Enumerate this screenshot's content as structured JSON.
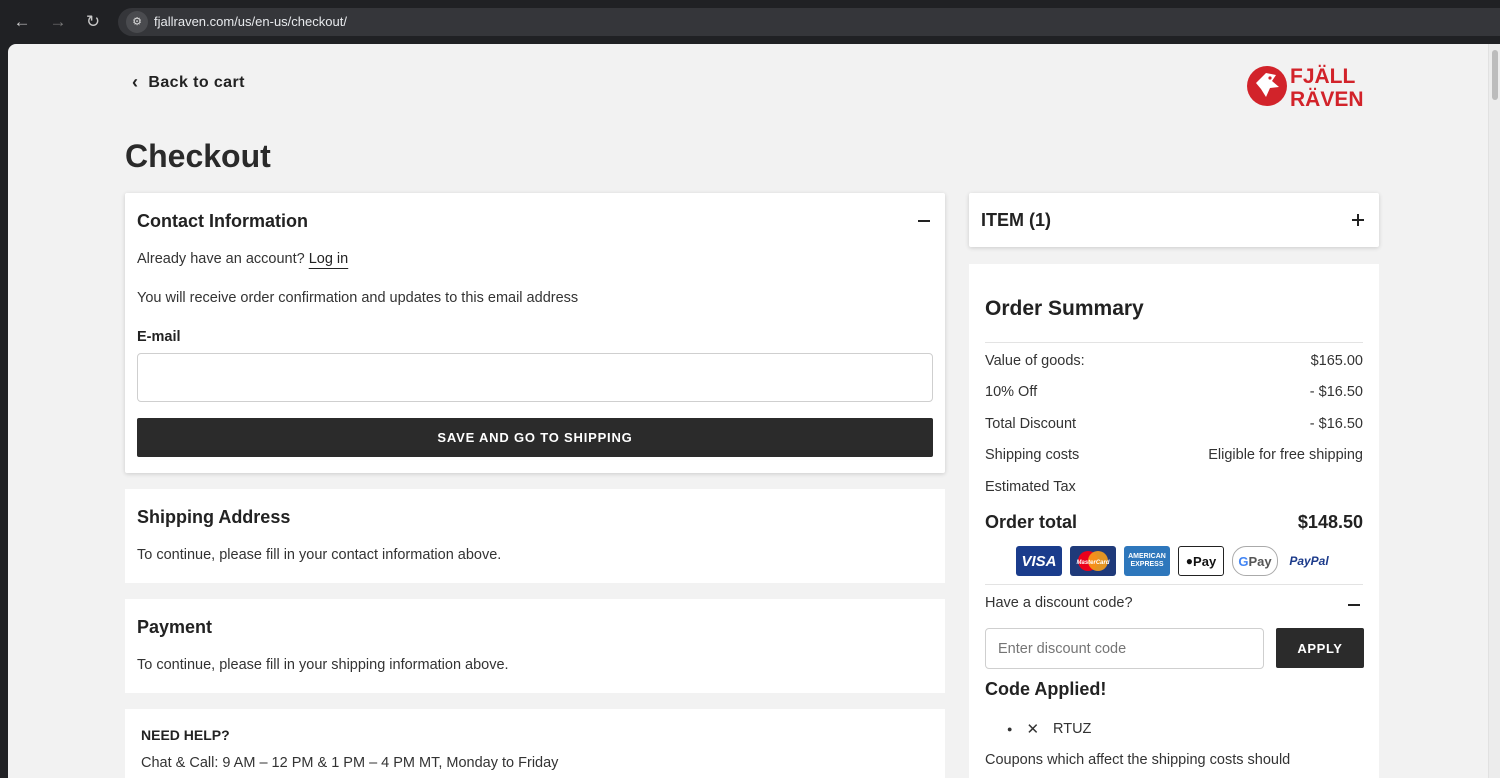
{
  "browser": {
    "url": "fjallraven.com/us/en-us/checkout/"
  },
  "header": {
    "back_label": "Back to cart",
    "logo_line1": "FJÄLL",
    "logo_line2": "RÄVEN",
    "brand_color": "#d2232a"
  },
  "page_title": "Checkout",
  "contact": {
    "heading": "Contact Information",
    "account_prompt": "Already have an account?",
    "login_label": "Log in",
    "info_text": "You will receive order confirmation and updates to this email address",
    "email_label": "E-mail",
    "email_value": "",
    "save_button": "SAVE AND GO TO SHIPPING"
  },
  "shipping": {
    "heading": "Shipping Address",
    "text": "To continue, please fill in your contact information above."
  },
  "payment": {
    "heading": "Payment",
    "text": "To continue, please fill in your shipping information above."
  },
  "help": {
    "heading": "NEED HELP?",
    "text": "Chat & Call: 9 AM – 12 PM & 1 PM – 4 PM MT, Monday to Friday"
  },
  "item": {
    "label": "ITEM (1)"
  },
  "summary": {
    "heading": "Order Summary",
    "rows": [
      {
        "label": "Value of goods:",
        "value": "$165.00"
      },
      {
        "label": "10% Off",
        "value": "- $16.50"
      },
      {
        "label": "Total Discount",
        "value": "- $16.50"
      },
      {
        "label": "Shipping costs",
        "value": "Eligible for free shipping"
      },
      {
        "label": "Estimated Tax",
        "value": ""
      }
    ],
    "total_label": "Order total",
    "total_value": "$148.50",
    "payment_methods": [
      "VISA",
      "MasterCard",
      "AMERICAN EXPRESS",
      "Pay",
      "Pay",
      "PayPal"
    ],
    "discount_prompt": "Have a discount code?",
    "discount_placeholder": "Enter discount code",
    "apply_label": "APPLY",
    "code_applied_heading": "Code Applied!",
    "applied_code": "RTUZ",
    "coupon_note": "Coupons which affect the shipping costs should"
  }
}
